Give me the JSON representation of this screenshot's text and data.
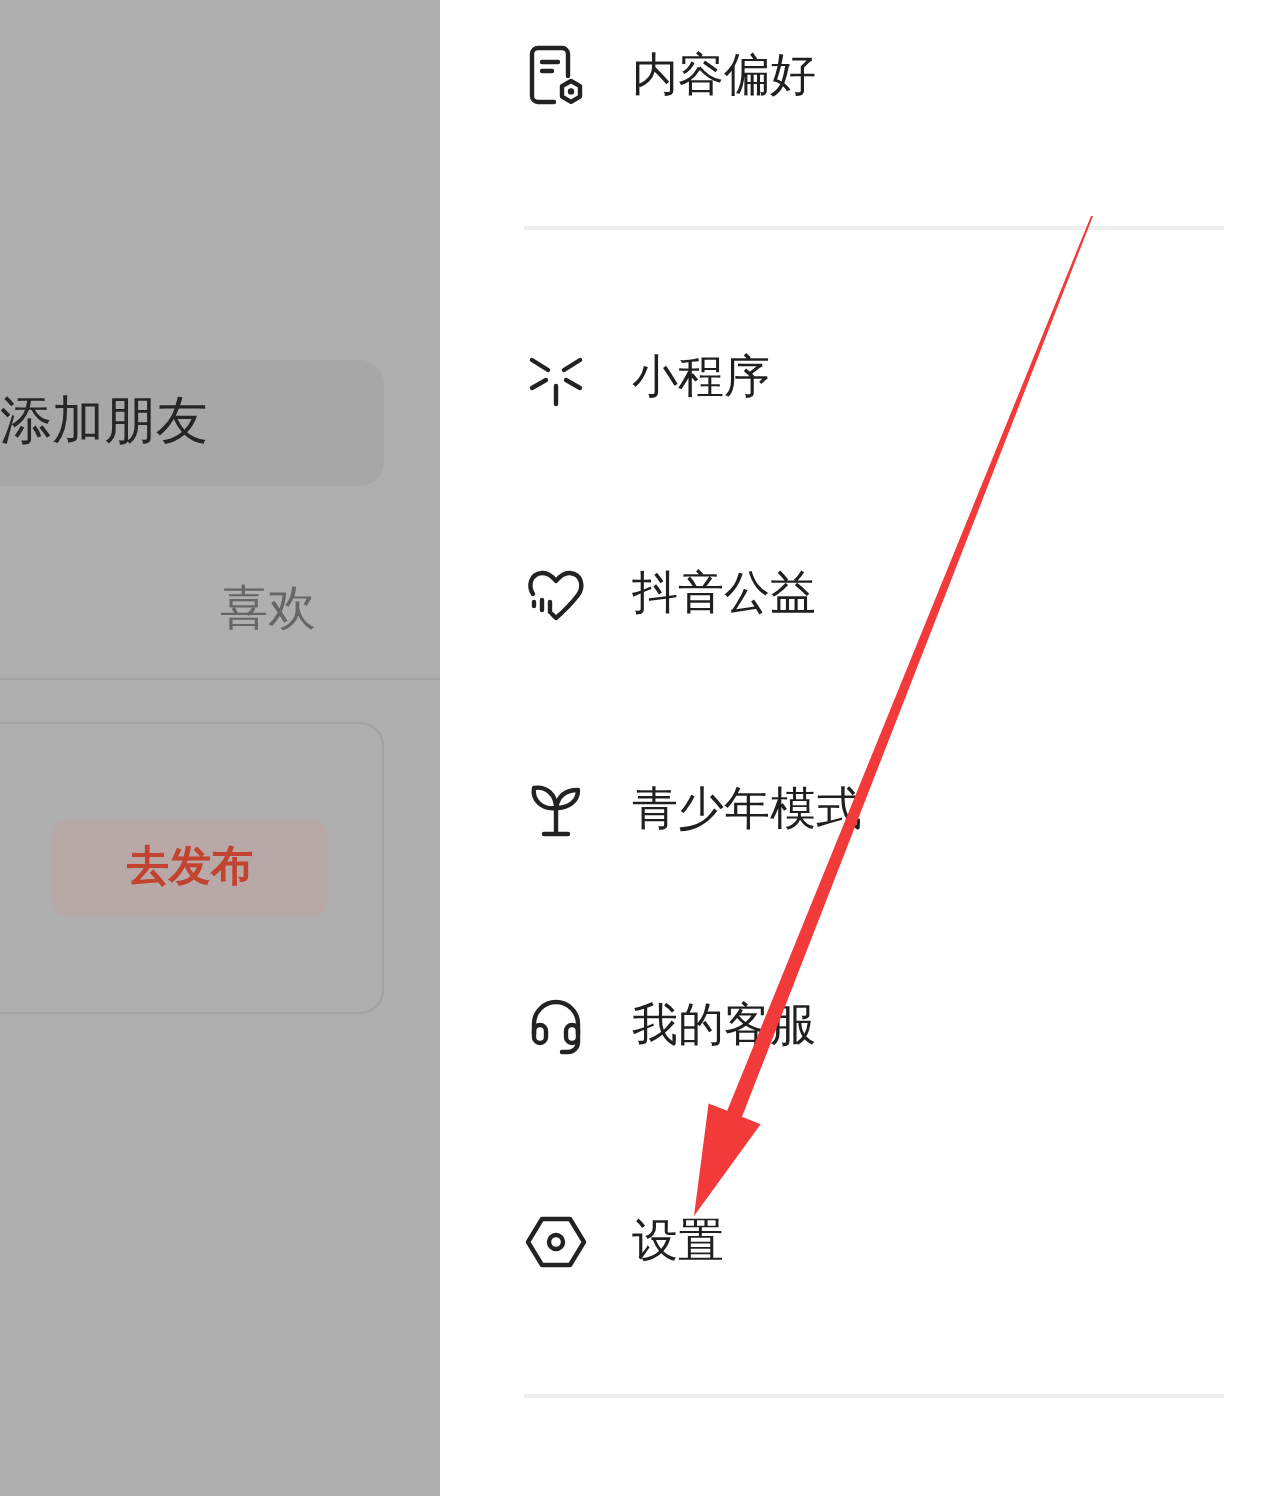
{
  "background": {
    "add_friend_button": "添加朋友",
    "tab": "喜欢",
    "publish_button": "去发布"
  },
  "menu": [
    {
      "kind": "document",
      "label": "内容偏好"
    },
    {
      "kind": "divider"
    },
    {
      "kind": "mini_program",
      "label": "小程序"
    },
    {
      "kind": "charity",
      "label": "抖音公益"
    },
    {
      "kind": "sprout",
      "label": "青少年模式"
    },
    {
      "kind": "headset",
      "label": "我的客服"
    },
    {
      "kind": "settings",
      "label": "设置"
    },
    {
      "kind": "divider"
    }
  ]
}
